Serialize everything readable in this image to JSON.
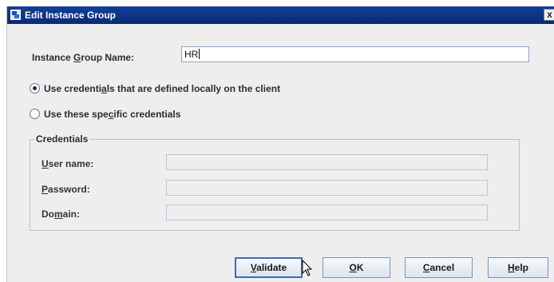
{
  "window": {
    "title": "Edit Instance Group",
    "close_glyph": "x"
  },
  "instance_group": {
    "label_pre": "Instance ",
    "label_mnemonic": "G",
    "label_post": "roup Name:",
    "value": "HR"
  },
  "options": {
    "local": {
      "pre": "Use credenti",
      "mnemonic": "a",
      "post": "ls that are defined locally on the client",
      "checked": true
    },
    "specific": {
      "pre": "Use these spe",
      "mnemonic": "c",
      "post": "ific credentials",
      "checked": false
    }
  },
  "credentials": {
    "legend": "Credentials",
    "user": {
      "mnemonic": "U",
      "post": "ser name:",
      "value": ""
    },
    "password": {
      "mnemonic": "P",
      "post": "assword:",
      "value": ""
    },
    "domain": {
      "pre": "Do",
      "mnemonic": "m",
      "post": "ain:",
      "value": ""
    }
  },
  "buttons": {
    "validate": {
      "mnemonic": "V",
      "post": "alidate"
    },
    "ok": {
      "mnemonic": "O",
      "post": "K"
    },
    "cancel": {
      "mnemonic": "C",
      "post": "ancel"
    },
    "help": {
      "mnemonic": "H",
      "post": "elp"
    }
  },
  "icons": {
    "window": "window-app-icon",
    "close": "close-icon",
    "pointer": "mouse-pointer-icon"
  }
}
